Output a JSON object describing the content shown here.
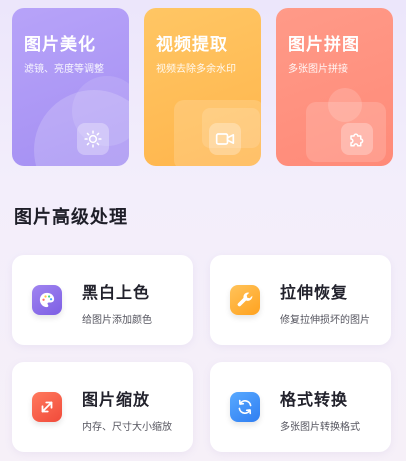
{
  "top_cards": [
    {
      "title": "图片美化",
      "subtitle": "滤镜、亮度等调整",
      "icon": "sun-icon"
    },
    {
      "title": "视频提取",
      "subtitle": "视频去除多余水印",
      "icon": "video-camera-icon"
    },
    {
      "title": "图片拼图",
      "subtitle": "多张图片拼接",
      "icon": "puzzle-icon"
    }
  ],
  "section": {
    "title": "图片高级处理"
  },
  "tools": [
    {
      "title": "黑白上色",
      "subtitle": "给图片添加颜色",
      "icon": "palette-icon"
    },
    {
      "title": "拉伸恢复",
      "subtitle": "修复拉伸损坏的图片",
      "icon": "wrench-icon"
    },
    {
      "title": "图片缩放",
      "subtitle": "内存、尺寸大小缩放",
      "icon": "resize-arrows-icon"
    },
    {
      "title": "格式转换",
      "subtitle": "多张图片转换格式",
      "icon": "convert-icon"
    }
  ],
  "colors": {
    "beautify": "#a895f6",
    "video": "#ffbd58",
    "collage": "#ff927f",
    "colorize": "#8c6ff0",
    "stretch": "#ffaf2e",
    "zoom": "#f6573f",
    "convert": "#3a8cf8"
  }
}
